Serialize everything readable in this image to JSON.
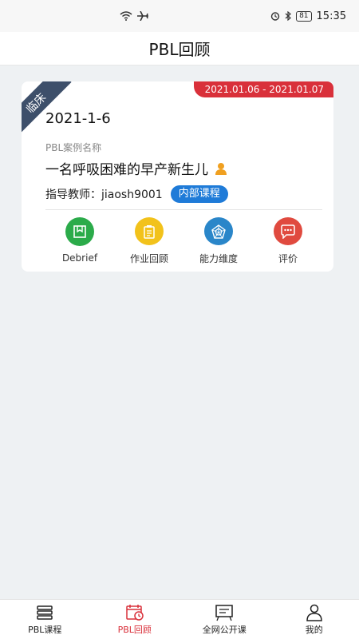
{
  "status_bar": {
    "time": "15:35",
    "battery": "81",
    "icons": [
      "wifi-icon",
      "airplane-icon",
      "alarm-icon",
      "bluetooth-icon",
      "battery-icon"
    ]
  },
  "header": {
    "title": "PBL回顾"
  },
  "card": {
    "corner_tag": "临床",
    "date_range": "2021.01.06 - 2021.01.07",
    "date": "2021-1-6",
    "case_label": "PBL案例名称",
    "case_title": "一名呼吸困难的早产新生儿",
    "teacher_label": "指导教师：jiaosh9001",
    "course_badge": "内部课程",
    "actions": [
      {
        "label": "Debrief",
        "icon": "debrief-icon",
        "color": "#2bab4a"
      },
      {
        "label": "作业回顾",
        "icon": "clipboard-icon",
        "color": "#f2c21b"
      },
      {
        "label": "能力维度",
        "icon": "radar-icon",
        "color": "#2a86c9"
      },
      {
        "label": "评价",
        "icon": "chat-icon",
        "color": "#e04a3f"
      }
    ]
  },
  "bottom_nav": {
    "items": [
      {
        "label": "PBL课程",
        "icon": "book-stack-icon",
        "active": false
      },
      {
        "label": "PBL回顾",
        "icon": "calendar-clock-icon",
        "active": true
      },
      {
        "label": "全网公开课",
        "icon": "public-board-icon",
        "active": false
      },
      {
        "label": "我的",
        "icon": "person-icon",
        "active": false
      }
    ]
  },
  "colors": {
    "accent_red": "#d9303a",
    "badge_blue": "#1f7bd8",
    "tag_navy": "#3d4f6a",
    "background": "#eef1f3"
  }
}
